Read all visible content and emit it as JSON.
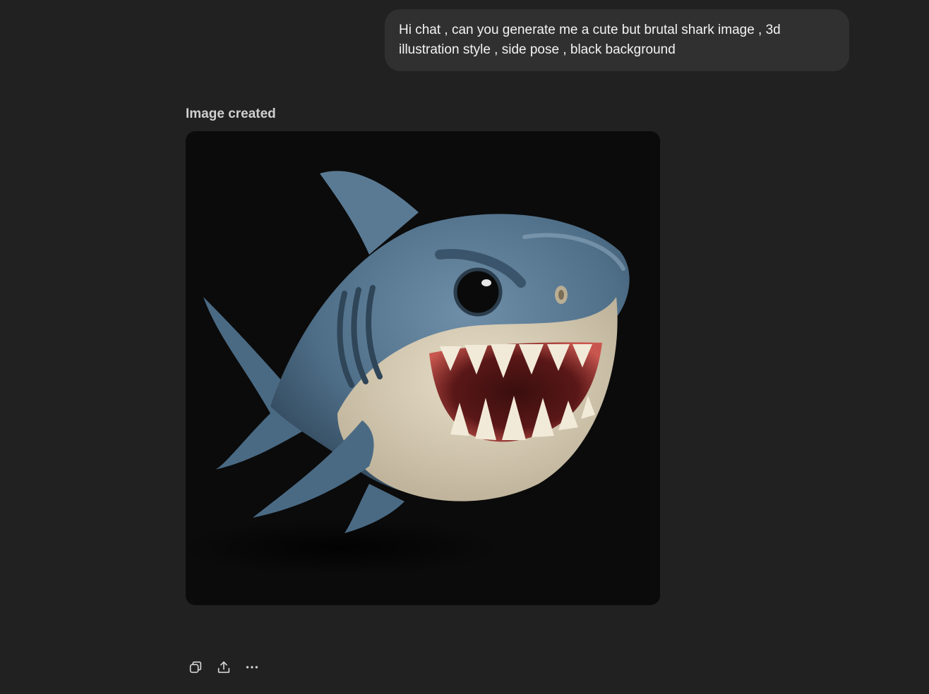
{
  "conversation": {
    "user_message": "Hi chat , can you generate me a cute but brutal shark image , 3d illustration style , side pose , black background",
    "assistant": {
      "status_label": "Image created",
      "image": {
        "icon": "shark-illustration",
        "background_color": "#0b0b0b",
        "body_color": "#4f6f89",
        "belly_color": "#d9cdb4",
        "mouth_color": "#c9574f"
      }
    },
    "actions": [
      {
        "icon": "copy-icon"
      },
      {
        "icon": "share-icon"
      },
      {
        "icon": "more-icon"
      }
    ]
  },
  "theme": {
    "background": "#212121",
    "bubble": "#303030",
    "text": "#ececec"
  }
}
